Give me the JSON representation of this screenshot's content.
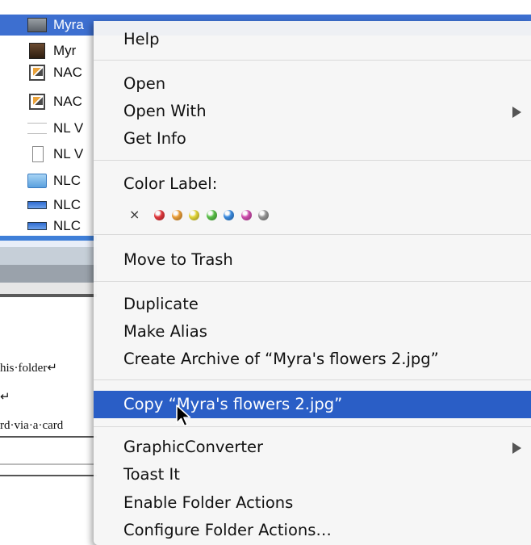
{
  "finder": {
    "files": [
      {
        "name": "Myra",
        "icon": "jpeg-thumbnail-icon",
        "selected": true
      },
      {
        "name": "Myr",
        "icon": "photo-thumbnail-icon",
        "selected": false
      },
      {
        "name": "NAC",
        "icon": "document-icon",
        "selected": false
      },
      {
        "name": "NAC",
        "icon": "document-icon",
        "selected": false
      },
      {
        "name": "NL V",
        "icon": "blank-file-icon",
        "selected": false
      },
      {
        "name": "NL V",
        "icon": "page-file-icon",
        "selected": false
      },
      {
        "name": "NLC",
        "icon": "folder-icon",
        "selected": false
      },
      {
        "name": "NLC",
        "icon": "strip-file-icon",
        "selected": false
      },
      {
        "name": "NLC",
        "icon": "strip-file-icon",
        "selected": false
      }
    ]
  },
  "document": {
    "lines": [
      "his·folder↵",
      "↵",
      "rd·via·a·card"
    ]
  },
  "menu": {
    "help": "Help",
    "open": "Open",
    "open_with": "Open With",
    "get_info": "Get Info",
    "color_label_heading": "Color Label:",
    "no_label_glyph": "×",
    "label_colors": [
      "#e8383d",
      "#f2a33a",
      "#e9dc3a",
      "#5cc64a",
      "#3a8ee6",
      "#d64fb4",
      "#9a9a9a"
    ],
    "move_to_trash": "Move to Trash",
    "duplicate": "Duplicate",
    "make_alias": "Make Alias",
    "create_archive": "Create Archive of “Myra's flowers 2.jpg”",
    "copy": "Copy “Myra's flowers 2.jpg”",
    "graphic_converter": "GraphicConverter",
    "toast_it": "Toast It",
    "enable_folder_actions": "Enable Folder Actions",
    "configure_folder_actions": "Configure Folder Actions…"
  },
  "colors": {
    "selection": "#3d6fd0",
    "menu_highlight": "#2a5ec6"
  }
}
